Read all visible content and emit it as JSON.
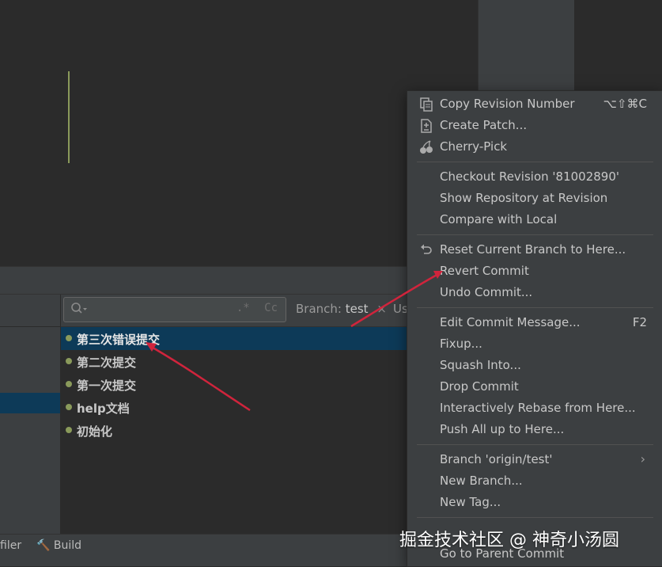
{
  "bottom_bar": {
    "profiler_label": "filer",
    "build_label": "Build"
  },
  "search": {
    "regex_icon": ".*",
    "case_icon": "Cc"
  },
  "filters": {
    "branch_label": "Branch:",
    "branch_value": "test",
    "user_label": "Us"
  },
  "commits": [
    {
      "subject": "第三次错误提交",
      "selected": true
    },
    {
      "subject": "第二次提交",
      "selected": false
    },
    {
      "subject": "第一次提交",
      "selected": false
    },
    {
      "subject": "help文档",
      "selected": false
    },
    {
      "subject": "初始化",
      "selected": false
    }
  ],
  "context_menu": {
    "groups": [
      [
        {
          "label": "Copy Revision Number",
          "shortcut": "⌥⇧⌘C",
          "icon": "copy-icon"
        },
        {
          "label": "Create Patch...",
          "icon": "patch-icon"
        },
        {
          "label": "Cherry-Pick",
          "icon": "cherry-icon"
        }
      ],
      [
        {
          "label": "Checkout Revision '81002890'"
        },
        {
          "label": "Show Repository at Revision"
        },
        {
          "label": "Compare with Local"
        }
      ],
      [
        {
          "label": "Reset Current Branch to Here...",
          "icon": "undo-icon"
        },
        {
          "label": "Revert Commit"
        },
        {
          "label": "Undo Commit..."
        }
      ],
      [
        {
          "label": "Edit Commit Message...",
          "shortcut": "F2"
        },
        {
          "label": "Fixup..."
        },
        {
          "label": "Squash Into..."
        },
        {
          "label": "Drop Commit"
        },
        {
          "label": "Interactively Rebase from Here..."
        },
        {
          "label": "Push All up to Here..."
        }
      ],
      [
        {
          "label": "Branch 'origin/test'",
          "submenu": true
        },
        {
          "label": "New Branch..."
        },
        {
          "label": "New Tag..."
        }
      ],
      [
        {
          "label": "Go to Parent Commit"
        }
      ]
    ]
  },
  "watermark": "掘金技术社区 @ 神奇小汤圆",
  "colors": {
    "editor_bg": "#2b2b2b",
    "panel_bg": "#3c3f41",
    "selection": "#0d3a58",
    "graph": "#8a9a5b",
    "annotation_arrow": "#d0243c"
  }
}
